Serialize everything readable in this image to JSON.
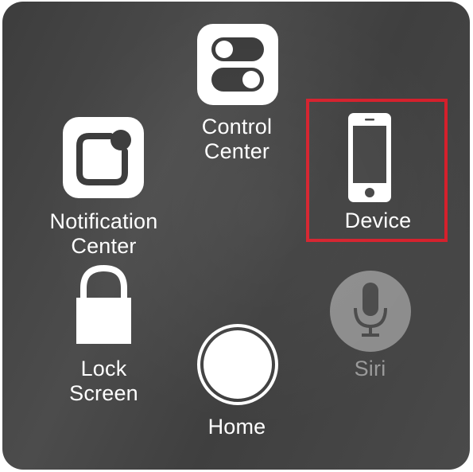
{
  "menu": {
    "items": [
      {
        "id": "control_center",
        "label": "Control\nCenter",
        "icon": "toggles-icon"
      },
      {
        "id": "notification_center",
        "label": "Notification\nCenter",
        "icon": "notification-badge-icon"
      },
      {
        "id": "device",
        "label": "Device",
        "icon": "iphone-icon",
        "highlighted": true
      },
      {
        "id": "lock_screen",
        "label": "Lock\nScreen",
        "icon": "padlock-icon"
      },
      {
        "id": "siri",
        "label": "Siri",
        "icon": "microphone-icon",
        "disabled": true
      },
      {
        "id": "home",
        "label": "Home",
        "icon": "home-circle-icon"
      }
    ]
  },
  "colors": {
    "panel": "#444444",
    "icon_tile": "#ffffff",
    "highlight": "#d51f2b",
    "disabled_text": "#9a9a9a"
  }
}
